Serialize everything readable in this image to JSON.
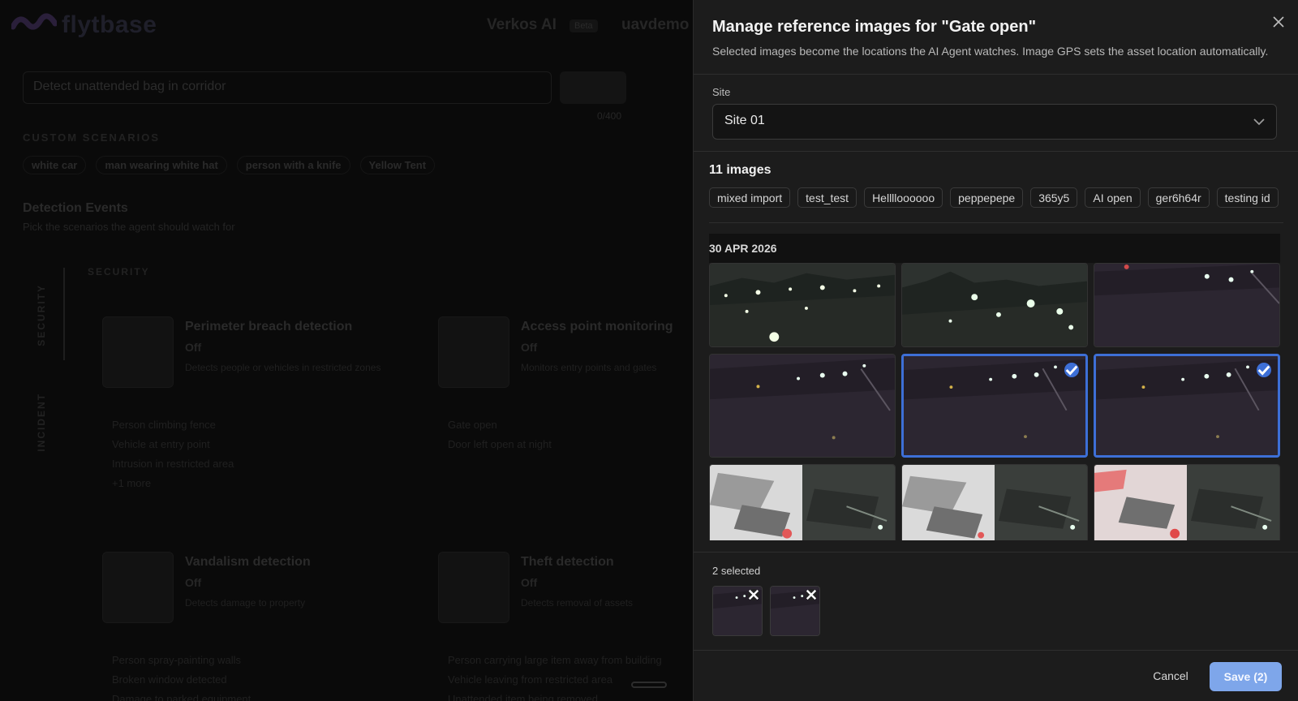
{
  "background": {
    "brand": "flytbase",
    "top_title": "Verkos AI",
    "top_badge": "Beta",
    "top_user": "uavdemo",
    "prompt_input": "Detect unattended bag in corridor",
    "char_count": "0/400",
    "custom_scenarios_heading": "CUSTOM SCENARIOS",
    "custom_scenarios": [
      "white car",
      "man wearing white hat",
      "person with a knife",
      "Yellow Tent"
    ],
    "events_heading": "Detection Events",
    "events_subtitle": "Pick the scenarios the agent should watch for",
    "vertical_tabs": [
      "SECURITY",
      "INCIDENT"
    ],
    "category": "SECURITY",
    "cards": [
      {
        "title": "Perimeter breach detection",
        "status": "Off",
        "meta": "Detects people or vehicles in restricted zones",
        "lines": [
          "Person climbing fence",
          "Vehicle at entry point",
          "Intrusion in restricted area",
          "+1 more"
        ]
      },
      {
        "title": "Access point monitoring",
        "status": "Off",
        "meta": "Monitors entry points and gates",
        "lines": [
          "Gate open",
          "Door left open at night"
        ]
      },
      {
        "title": "Vandalism detection",
        "status": "Off",
        "meta": "Detects damage to property",
        "lines": [
          "Person spray-painting walls",
          "Broken window detected",
          "Damage to parked equipment"
        ]
      },
      {
        "title": "Theft detection",
        "status": "Off",
        "meta": "Detects removal of assets",
        "lines": [
          "Person carrying large item away from building",
          "Vehicle leaving from restricted area",
          "Unattended item being removed"
        ]
      }
    ]
  },
  "dialog": {
    "title": "Manage reference images for \"Gate open\"",
    "description": "Selected images become the locations the AI Agent watches. Image GPS sets the asset location automatically.",
    "site_label": "Site",
    "site_value": "Site 01",
    "image_count": "11 images",
    "tags": [
      "mixed import",
      "test_test",
      "Helllloooooo",
      "peppepepe",
      "365y5",
      "AI open",
      "ger6h64r",
      "testing id"
    ],
    "gallery_date": "30 APR 2026",
    "thumbnails": [
      {
        "scene": "night-city",
        "selected": false
      },
      {
        "scene": "night-hills",
        "selected": false
      },
      {
        "scene": "night-street",
        "selected": false
      },
      {
        "scene": "night-street",
        "selected": false
      },
      {
        "scene": "night-street",
        "selected": true
      },
      {
        "scene": "night-street",
        "selected": true
      },
      {
        "scene": "thermal-split",
        "selected": false
      },
      {
        "scene": "thermal-split",
        "selected": false
      },
      {
        "scene": "thermal-split",
        "selected": false
      }
    ],
    "selected_label": "2 selected",
    "cancel_label": "Cancel",
    "save_label": "Save (2)",
    "colors": {
      "accent": "#3d6fd6",
      "save_button": "#7ea6ea",
      "panel": "#1c1c1c"
    }
  }
}
